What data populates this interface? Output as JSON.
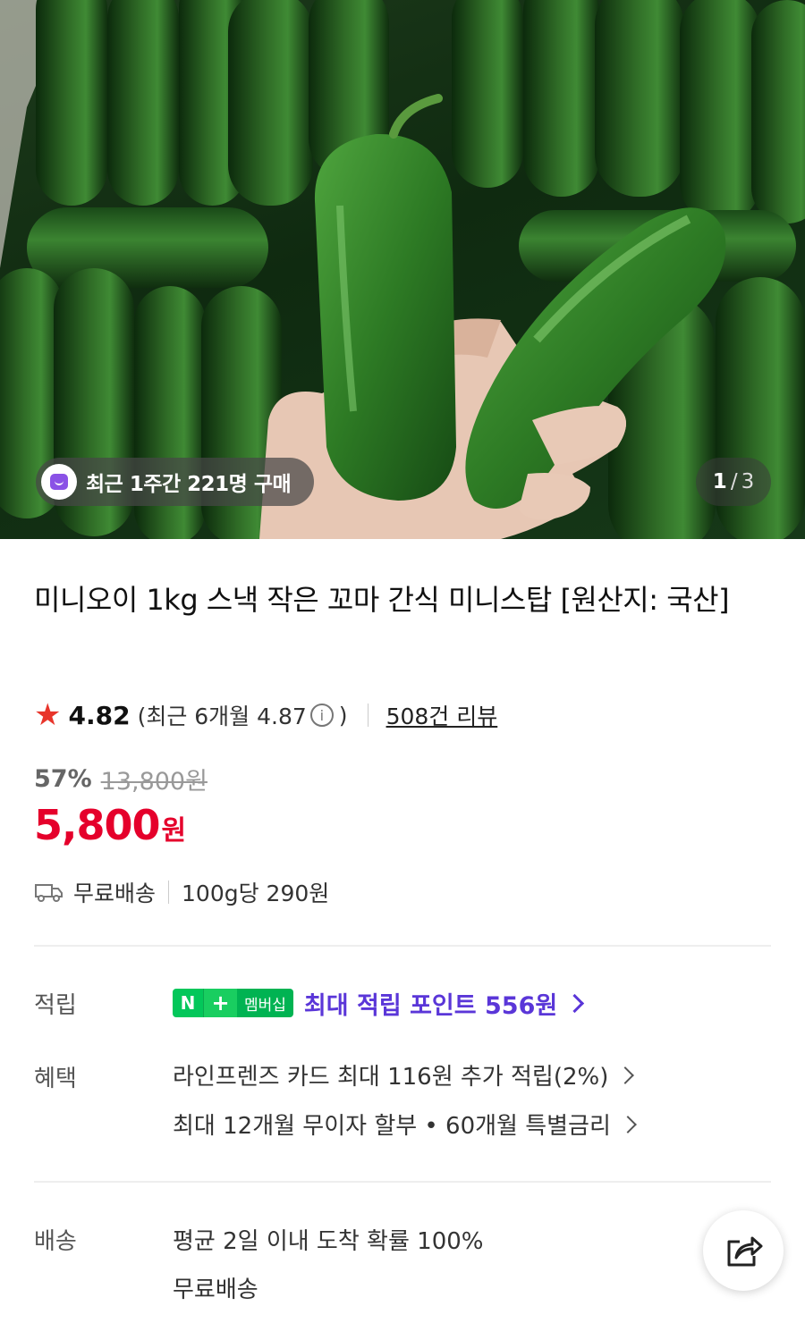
{
  "hero": {
    "badge_text": "최근 1주간 221명 구매",
    "pager_current": "1",
    "pager_separator": "/",
    "pager_total": "3"
  },
  "product": {
    "title": "미니오이 1kg 스낵 작은 꼬마 간식 미니스탑 [원산지: 국산]",
    "rating": "4.82",
    "recent_rating_open": "(최근 6개월 4.87",
    "recent_rating_close": ")",
    "review_count": "508건 리뷰",
    "discount": "57%",
    "original_price": "13,800원",
    "price": "5,800",
    "price_unit": "원",
    "shipping": "무료배송",
    "unit_price": "100g당 290원"
  },
  "points": {
    "label": "적립",
    "npay_n": "N",
    "npay_plus": "+",
    "npay_membership": "멤버십",
    "text": "최대 적립 포인트 556원"
  },
  "benefits": {
    "label": "혜택",
    "items": [
      "라인프렌즈 카드 최대 116원 추가 적립(2%)",
      "최대 12개월 무이자 할부 • 60개월 특별금리"
    ]
  },
  "delivery": {
    "label": "배송",
    "line1": "평균 2일 이내 도착 확률 100%",
    "line2": "무료배송"
  },
  "colors": {
    "price_red": "#e5002b",
    "star_red": "#e8352b",
    "points_purple": "#5a36d8",
    "npay_green": "#03c75a"
  }
}
